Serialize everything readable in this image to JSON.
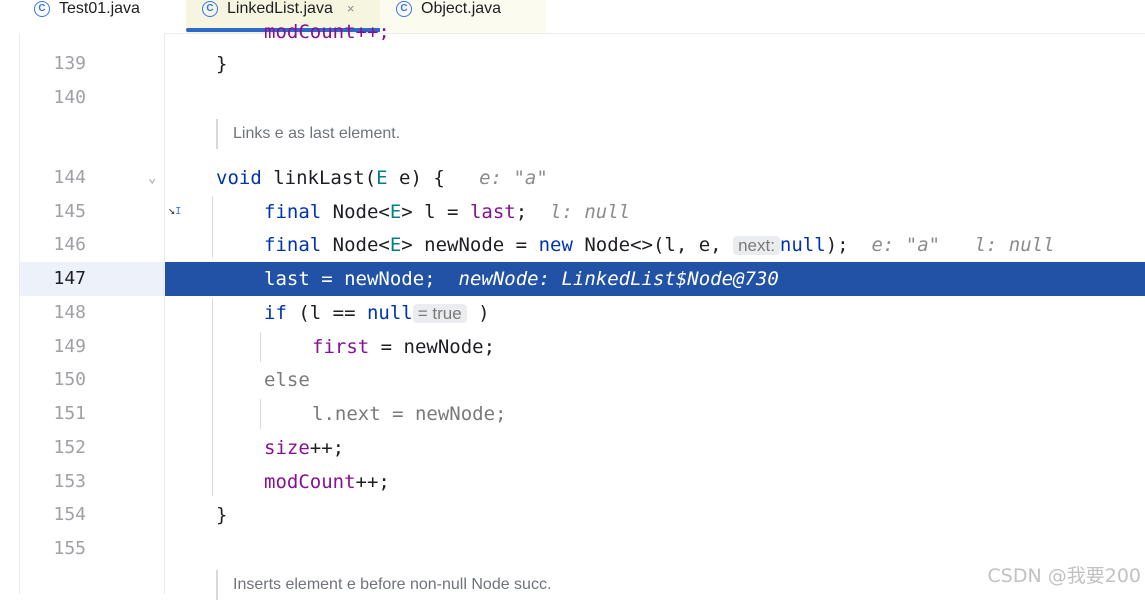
{
  "tabs": [
    {
      "label": "Test01.java",
      "icon": "class-icon"
    },
    {
      "label": "LinkedList.java",
      "icon": "class-icon",
      "active": true,
      "close": "×"
    },
    {
      "label": "Object.java",
      "icon": "class-icon"
    }
  ],
  "tab_icon_glyph": "C",
  "docs": {
    "link_last": "Links e as last element.",
    "link_before": "Inserts element e before non-null Node succ."
  },
  "lines": {
    "139": {
      "num": "139",
      "text": "}"
    },
    "140": {
      "num": "140"
    },
    "144": {
      "num": "144",
      "t1": "void",
      "t2": " linkLast(",
      "t3": "E",
      "t4": " e) {",
      "hint": "e: \"a\""
    },
    "145": {
      "num": "145",
      "t1": "final",
      "t2": " Node<",
      "t3": "E",
      "t4": "> l = ",
      "t5": "last",
      "t6": ";",
      "hint": "l: null"
    },
    "146": {
      "num": "146",
      "t1": "final",
      "t2": " Node<",
      "t3": "E",
      "t4": "> newNode = ",
      "t5": "new",
      "t6": " Node<>(l, e, ",
      "pill": "next:",
      "t7": "null",
      "t8": ");",
      "hint1": "e: \"a\"",
      "hint2": "l: null"
    },
    "147": {
      "num": "147",
      "t1": "last",
      "t2": " = newNode;",
      "hint": "newNode: LinkedList$Node@730"
    },
    "148": {
      "num": "148",
      "t1": "if",
      "t2": " (l == ",
      "t3": "null",
      "pill": "= true",
      "t4": " )"
    },
    "149": {
      "num": "149",
      "t1": "first",
      "t2": " = newNode;"
    },
    "150": {
      "num": "150",
      "t1": "else"
    },
    "151": {
      "num": "151",
      "t1": "l.next = newNode;"
    },
    "152": {
      "num": "152",
      "t1": "size",
      "t2": "++;"
    },
    "153": {
      "num": "153",
      "t1": "modCount",
      "t2": "++;"
    },
    "154": {
      "num": "154",
      "text": "}"
    },
    "155": {
      "num": "155"
    }
  },
  "top_clipped": "modCount++;",
  "watermark": "CSDN @我要200",
  "colors": {
    "keyword": "#0033b3",
    "field": "#871094",
    "type_param": "#007e8a",
    "highlight": "#2152a6",
    "tab_accent": "#2f69c6"
  }
}
